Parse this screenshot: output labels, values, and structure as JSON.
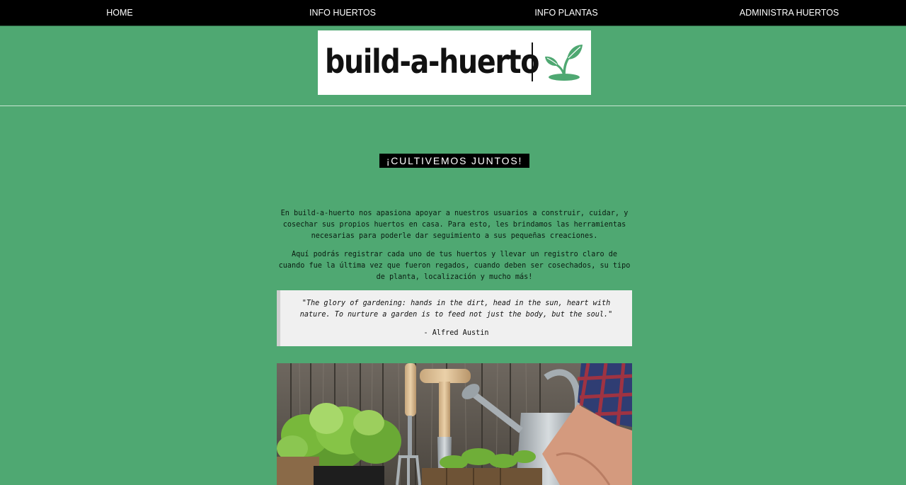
{
  "nav": {
    "home": "HOME",
    "info_huertos": "INFO HUERTOS",
    "info_plantas": "INFO PLANTAS",
    "administra_huertos": "ADMINISTRA HUERTOS"
  },
  "logo": {
    "text": "build-a-huerto",
    "icon": "sprout-icon"
  },
  "hero": {
    "banner": "¡CULTIVEMOS JUNTOS!"
  },
  "intro": {
    "paragraph_1": "En build-a-huerto nos apasiona apoyar a nuestros usuarios a construir, cuidar, y cosechar sus propios huertos en casa. Para esto, les brindamos las herramientas necesarias para poderle dar seguimiento a sus pequeñas creaciones.",
    "paragraph_2": "Aquí podrás registrar cada uno de tus huertos y llevar un registro claro de cuando fue la última vez que fueron regados, cuando deben ser cosechados, su tipo de planta, localización y mucho más!"
  },
  "quote": {
    "text": "\"The glory of gardening: hands in the dirt, head in the sun, heart with nature. To nurture a garden is to feed not just the body, but the soul.\"",
    "author": "- Alfred Austin"
  },
  "colors": {
    "page_background": "#4fa872",
    "nav_background": "#000000",
    "logo_green": "#4fa872",
    "quote_background": "#f0f0f0"
  }
}
